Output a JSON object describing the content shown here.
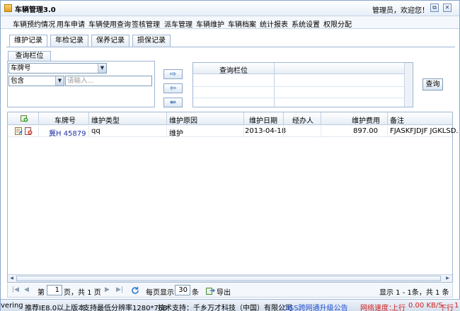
{
  "window": {
    "title": "车辆管理3.0",
    "greeting": "管理员，欢迎您！",
    "controls": {
      "restore": "⧉",
      "close": "✕"
    }
  },
  "menu": [
    "车辆预约情况",
    "用车申请",
    "车辆使用查询",
    "签核管理",
    "派车管理",
    "车辆维护",
    "车辆档案",
    "统计报表",
    "系统设置",
    "权限分配"
  ],
  "active_menu": "车辆维护",
  "subtabs": [
    "维护记录",
    "年检记录",
    "保养记录",
    "损保记录"
  ],
  "query": {
    "tab_label": "查询栏位",
    "field_select": "车牌号",
    "operator_select": "包含",
    "input_placeholder": "请输入...",
    "grid_header": "查询栏位",
    "query_button": "查询"
  },
  "table": {
    "columns": [
      "车牌号",
      "维护类型",
      "维护原因",
      "维护日期",
      "经办人",
      "维护费用",
      "备注"
    ],
    "rows": [
      {
        "plate": "冀H 45879",
        "type": "qq",
        "reason": "维护",
        "date": "2013-04-18",
        "handler": "",
        "cost": "897.00",
        "note": "FJASKFJDJF JGKLSD."
      }
    ]
  },
  "pager": {
    "page_prefix": "第",
    "page_value": "1",
    "page_suffix": "页，共 1 页",
    "per_page_label": "每页显示",
    "per_page_value": "30",
    "per_page_unit": "条",
    "export_label": "导出",
    "display_info": "显示 1 - 1条，共 1 条"
  },
  "statusbar": {
    "left_cut": "vering",
    "recommend": "推荐IE8.0以上版本",
    "resolution": "支持最低分辨率1280*768",
    "tech": "技术支持：千乡万才科技（中国）有限公司",
    "notice": "CISS跨网通升级公告",
    "speed_label": "网络速度：",
    "upload": "上行",
    "upload_speed": "0.00 KB/S",
    "download": "下行",
    "download_cut": "1"
  },
  "colors": {
    "accent_blue": "#2060b0",
    "border": "#9fb6d4",
    "notice": "#2050d0",
    "speed": "#d02020"
  },
  "icons": [
    "app-icon",
    "add-row-icon",
    "edit-icon",
    "delete-icon",
    "refresh-icon",
    "export-icon"
  ]
}
